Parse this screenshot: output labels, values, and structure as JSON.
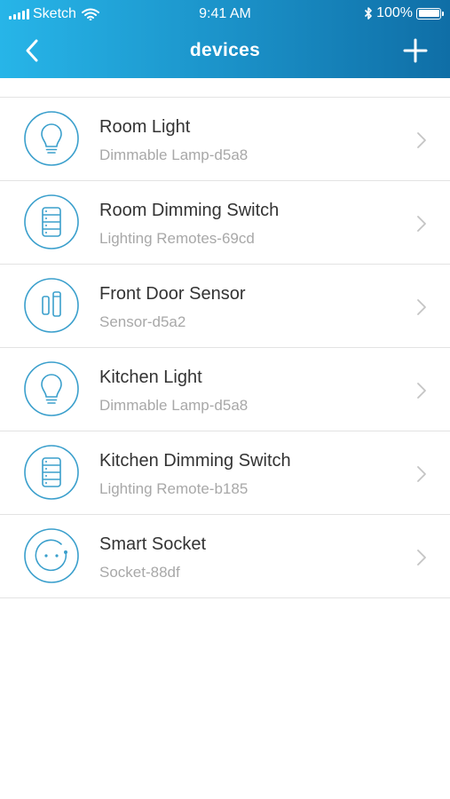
{
  "status_bar": {
    "carrier": "Sketch",
    "time": "9:41 AM",
    "battery": "100%"
  },
  "nav": {
    "title": "devices",
    "back_icon": "chevron-left-icon",
    "add_icon": "plus-icon"
  },
  "colors": {
    "header_start": "#27b5e8",
    "header_end": "#0f6ea6",
    "icon_accent": "#3a9fcc"
  },
  "devices": [
    {
      "name": "Room Light",
      "subtitle": "Dimmable Lamp-d5a8",
      "icon": "bulb-icon"
    },
    {
      "name": "Room Dimming Switch",
      "subtitle": "Lighting Remotes-69cd",
      "icon": "remote-icon"
    },
    {
      "name": "Front Door Sensor",
      "subtitle": "Sensor-d5a2",
      "icon": "sensor-icon"
    },
    {
      "name": "Kitchen Light",
      "subtitle": "Dimmable Lamp-d5a8",
      "icon": "bulb-icon"
    },
    {
      "name": "Kitchen Dimming Switch",
      "subtitle": "Lighting Remote-b185",
      "icon": "remote-icon"
    },
    {
      "name": "Smart Socket",
      "subtitle": "Socket-88df",
      "icon": "socket-icon"
    }
  ]
}
